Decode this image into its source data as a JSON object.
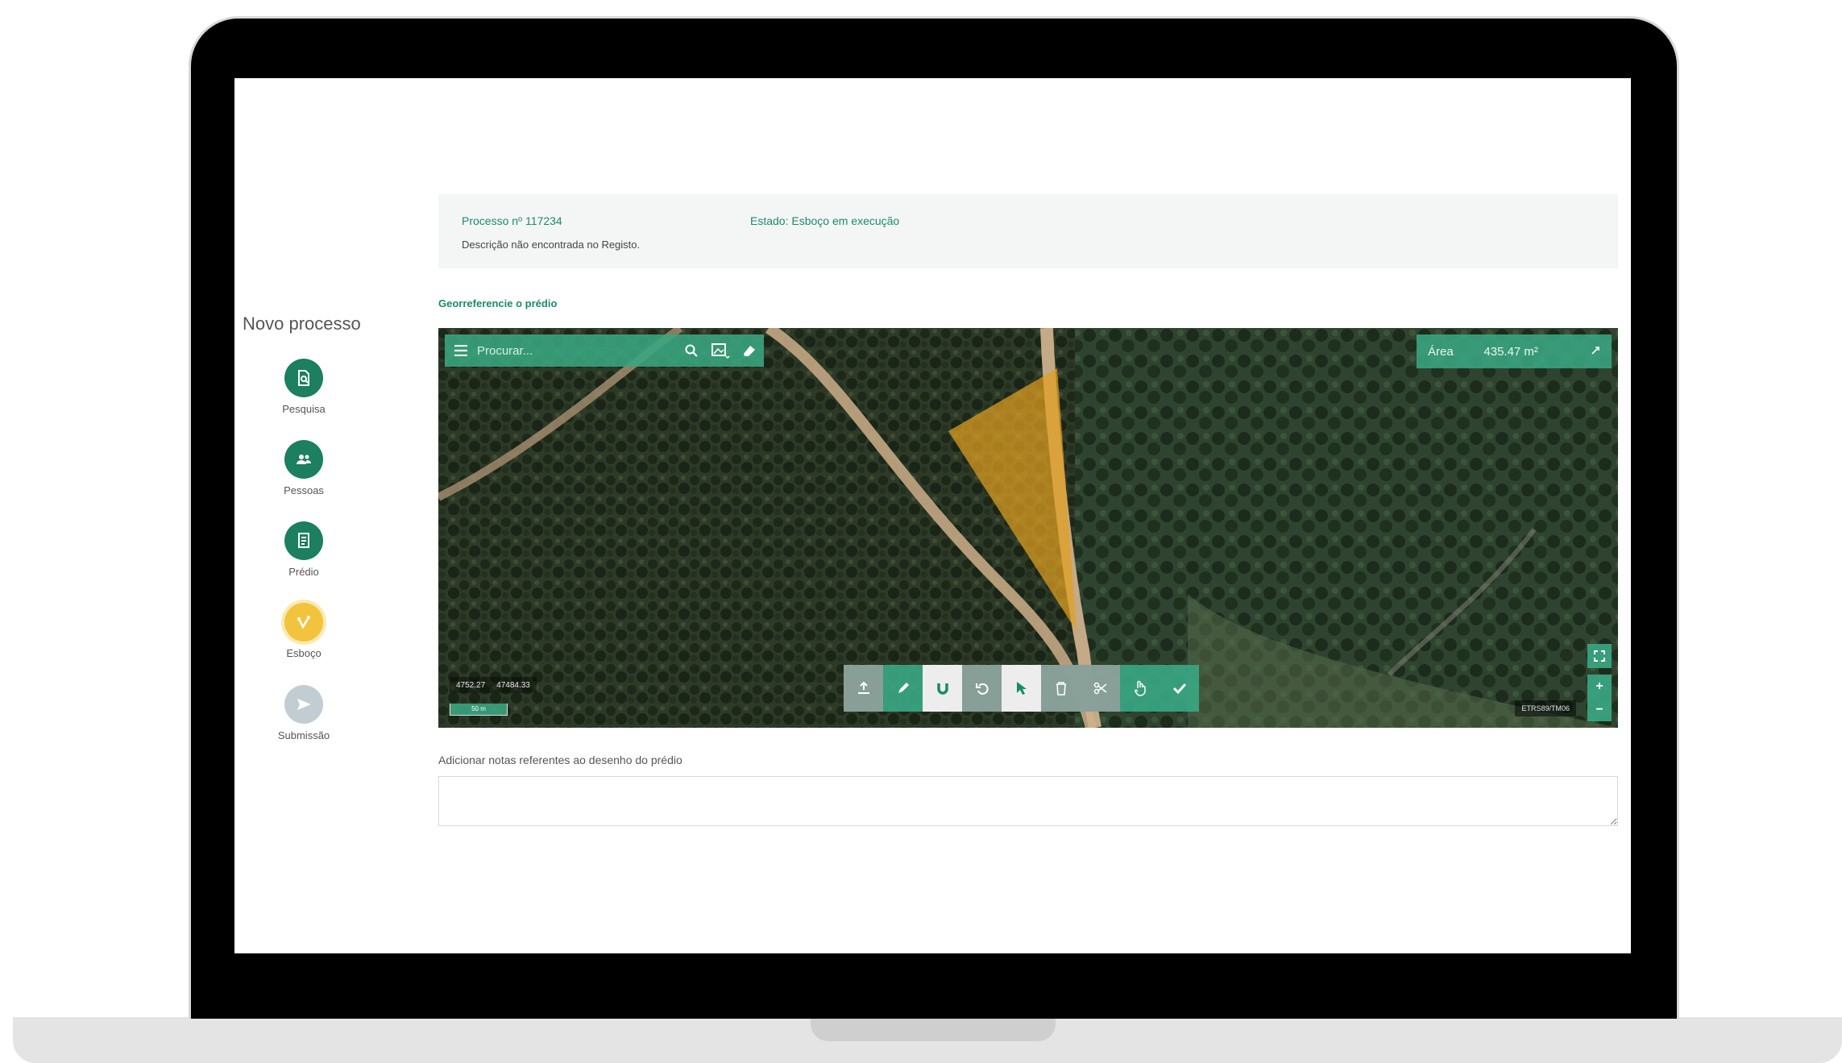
{
  "info": {
    "process_number": "Processo nº 117234",
    "state": "Estado: Esboço em execução",
    "description": "Descrição não encontrada no Registo."
  },
  "sidebar": {
    "title": "Novo processo",
    "steps": [
      {
        "label": "Pesquisa",
        "icon": "document-search-icon",
        "color": "#1c7f5f",
        "status": "done"
      },
      {
        "label": "Pessoas",
        "icon": "people-icon",
        "color": "#1c7f5f",
        "status": "done"
      },
      {
        "label": "Prédio",
        "icon": "document-icon",
        "color": "#1c7f5f",
        "status": "done"
      },
      {
        "label": "Esboço",
        "icon": "sketch-icon",
        "color": "#f2c43d",
        "status": "current"
      },
      {
        "label": "Submissão",
        "icon": "send-icon",
        "color": "#c2cdd3",
        "status": "pending"
      }
    ]
  },
  "map": {
    "section_title": "Georreferencie o prédio",
    "search_placeholder": "Procurar...",
    "area_label": "Área",
    "area_value": "435.47 m²",
    "coord_x": "4752.27",
    "coord_y": "47484.33",
    "scale_label": "50 m",
    "crs_label": "ETRS89/TM06",
    "accent_color": "#3aa682",
    "polygon_color": "#e0a020",
    "toolbar": [
      {
        "name": "upload",
        "icon": "upload-icon"
      },
      {
        "name": "draw",
        "icon": "pencil-icon"
      },
      {
        "name": "snap",
        "icon": "magnet-icon"
      },
      {
        "name": "undo",
        "icon": "undo-icon"
      },
      {
        "name": "select",
        "icon": "cursor-icon"
      },
      {
        "name": "delete",
        "icon": "trash-icon"
      },
      {
        "name": "cut",
        "icon": "scissors-icon"
      },
      {
        "name": "pan",
        "icon": "hand-icon"
      },
      {
        "name": "confirm",
        "icon": "check-icon"
      }
    ]
  },
  "notes": {
    "label": "Adicionar notas referentes ao desenho do prédio",
    "value": ""
  }
}
